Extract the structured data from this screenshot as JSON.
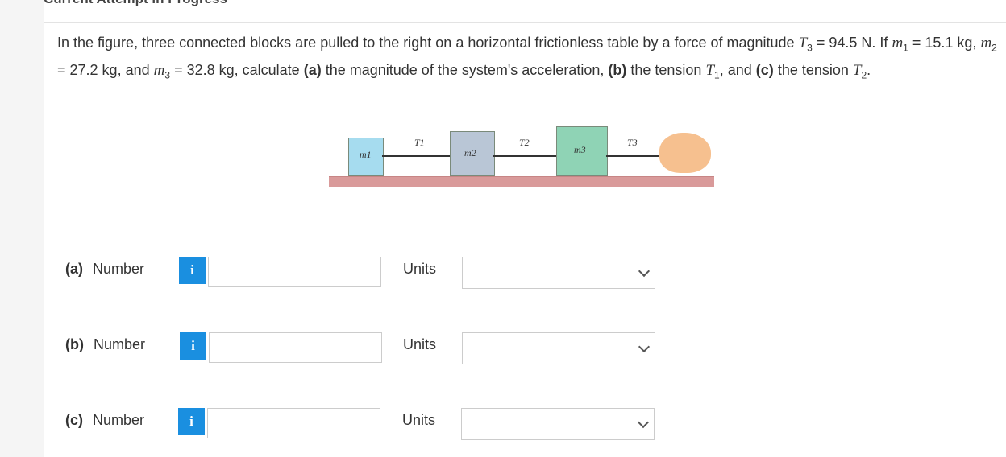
{
  "header": {
    "title": "Current Attempt in Progress"
  },
  "question": {
    "intro": "In the figure, three connected blocks are pulled to the right on a horizontal frictionless table by a force of magnitude",
    "t3_symbol": "T",
    "t3_sub": "3",
    "t3_value": "94.5 N",
    "if_text": "If",
    "m1_symbol": "m",
    "m1_sub": "1",
    "m1_value": "15.1 kg",
    "m2_symbol": "m",
    "m2_sub": "2",
    "m2_value": "27.2 kg",
    "and_text": "and",
    "m3_symbol": "m",
    "m3_sub": "3",
    "m3_value": "32.8 kg",
    "calc_text": "calculate",
    "part_a": "(a)",
    "part_a_text": "the magnitude of the system's acceleration,",
    "part_b": "(b)",
    "part_b_text": "the tension",
    "t1_symbol": "T",
    "t1_sub": "1",
    "and2": "and",
    "part_c": "(c)",
    "part_c_text": "the tension",
    "t2_symbol": "T",
    "t2_sub": "2"
  },
  "figure": {
    "block_labels": {
      "m1": "m1",
      "m2": "m2",
      "m3": "m3"
    },
    "tension_labels": {
      "t1": "T1",
      "t2": "T2",
      "t3": "T3"
    },
    "colors": {
      "m1": "#a6dcef",
      "m2": "#b9c6d6",
      "m3": "#8fd3b5",
      "table": "#d99a9a",
      "hand": "#f6c08f"
    }
  },
  "answers": [
    {
      "part": "(a)",
      "label": "Number",
      "info_icon": "i",
      "value": "",
      "units_label": "Units",
      "units_selected": ""
    },
    {
      "part": "(b)",
      "label": "Number",
      "info_icon": "i",
      "value": "",
      "units_label": "Units",
      "units_selected": ""
    },
    {
      "part": "(c)",
      "label": "Number",
      "info_icon": "i",
      "value": "",
      "units_label": "Units",
      "units_selected": ""
    }
  ],
  "colors": {
    "accent": "#1a8fe0",
    "text": "#333333",
    "border": "#cccccc"
  }
}
